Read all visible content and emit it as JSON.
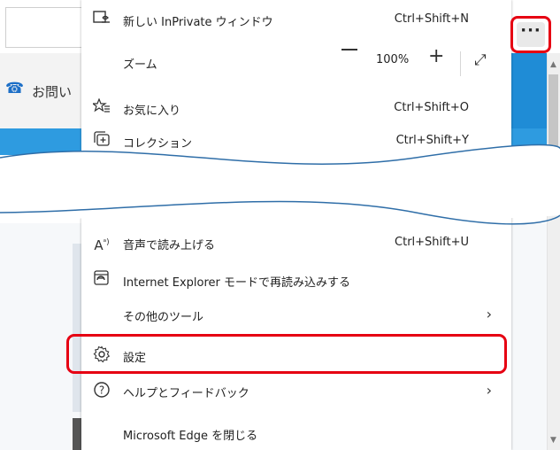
{
  "background": {
    "contact_label": "お問い",
    "phone_icon": "phone-icon"
  },
  "more_button": {
    "label": "···",
    "icon": "ellipsis-icon"
  },
  "menu": {
    "new_inprivate": {
      "label": "新しい InPrivate ウィンドウ",
      "shortcut": "Ctrl+Shift+N",
      "icon": "inprivate-window-icon"
    },
    "zoom": {
      "label": "ズーム",
      "minus": "—",
      "value": "100%",
      "plus": "+",
      "fullscreen": "⤢"
    },
    "favorites": {
      "label": "お気に入り",
      "shortcut": "Ctrl+Shift+O",
      "icon": "favorites-star-icon"
    },
    "collections": {
      "label": "コレクション",
      "shortcut": "Ctrl+Shift+Y",
      "icon": "collections-icon"
    },
    "read_aloud": {
      "label": "音声で読み上げる",
      "shortcut": "Ctrl+Shift+U",
      "icon": "read-aloud-icon"
    },
    "ie_mode": {
      "label": "Internet Explorer モードで再読み込みする",
      "icon": "ie-mode-icon"
    },
    "more_tools": {
      "label": "その他のツール",
      "arrow": "›"
    },
    "settings": {
      "label": "設定",
      "icon": "gear-icon"
    },
    "help": {
      "label": "ヘルプとフィードバック",
      "arrow": "›",
      "icon": "help-icon"
    },
    "close_edge": {
      "label": "Microsoft Edge を閉じる"
    }
  },
  "colors": {
    "highlight": "#e60012",
    "accent_blue": "#2e9be0"
  }
}
